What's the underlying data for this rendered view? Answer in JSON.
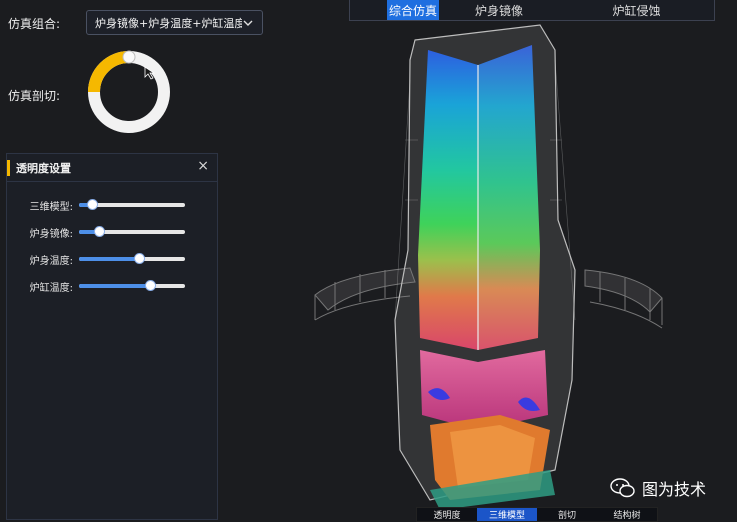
{
  "top_tabs": [
    {
      "label": "综合仿真",
      "active": true
    },
    {
      "label": "炉身镜像",
      "active": false
    },
    {
      "label": "炉缸侵蚀",
      "active": false
    }
  ],
  "sim_combo": {
    "label": "仿真组合:",
    "value": "炉身镜像+炉身温度+炉缸温度",
    "icon": "chevron-down-icon"
  },
  "sim_cut": {
    "label": "仿真剖切:",
    "level": 0.25,
    "accent": "#f5b800",
    "track": "#f2f2f2"
  },
  "panel": {
    "title": "透明度设置",
    "close": "×",
    "rows": [
      {
        "label": "三维模型:",
        "value": 0.13
      },
      {
        "label": "炉身镜像:",
        "value": 0.2
      },
      {
        "label": "炉身温度:",
        "value": 0.58
      },
      {
        "label": "炉缸温度:",
        "value": 0.68
      }
    ]
  },
  "bottom_nav": [
    {
      "label": "透明度",
      "active": false
    },
    {
      "label": "三维模型",
      "active": true
    },
    {
      "label": "剖切",
      "active": false
    },
    {
      "label": "结构树",
      "active": false
    }
  ],
  "watermark": "图为技术"
}
